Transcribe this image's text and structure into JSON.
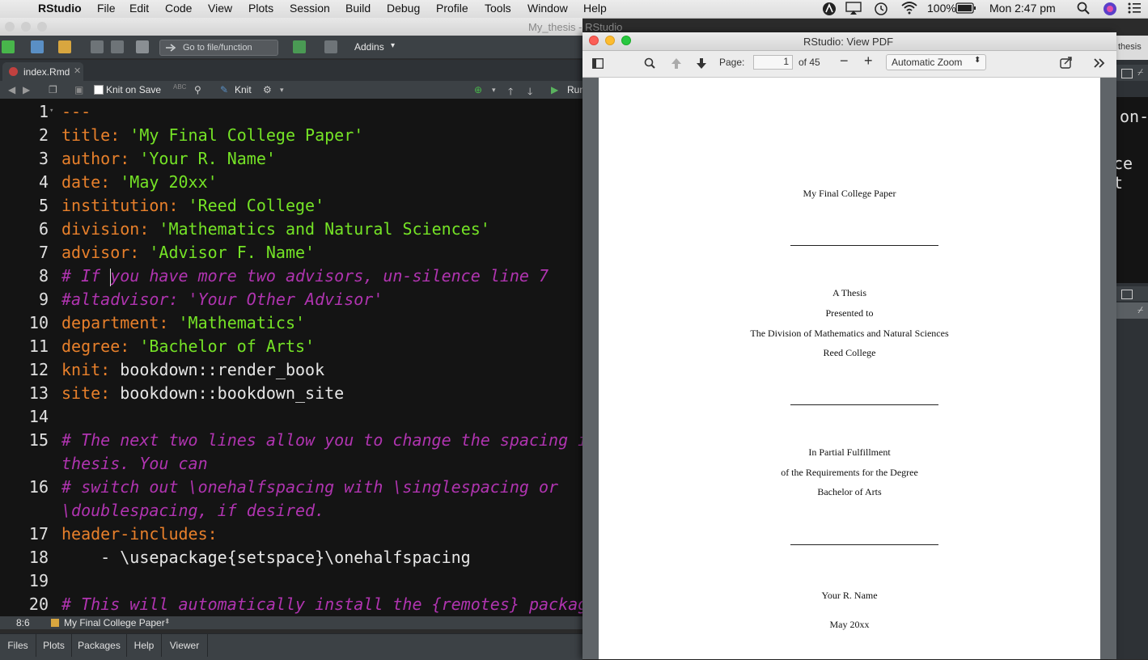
{
  "menubar": {
    "app": "RStudio",
    "items": [
      "File",
      "Edit",
      "Code",
      "View",
      "Plots",
      "Session",
      "Build",
      "Debug",
      "Profile",
      "Tools",
      "Window",
      "Help"
    ],
    "battery": "100%",
    "clock": "Mon 2:47 pm"
  },
  "rstudio": {
    "window_title": "My_thesis - RStudio",
    "goto_placeholder": "Go to file/function",
    "addins": "Addins",
    "tab": "index.Rmd",
    "knit_on_save": "Knit on Save",
    "knit": "Knit",
    "run": "Run",
    "status_pos": "8:6",
    "status_section": "My Final College Paper",
    "bottom_tabs": [
      "Files",
      "Plots",
      "Packages",
      "Help",
      "Viewer"
    ],
    "right_strip_text": [
      "thesis",
      "on-",
      "ce t"
    ]
  },
  "code_lines": [
    {
      "n": "1",
      "parts": [
        [
          "k",
          "---"
        ]
      ]
    },
    {
      "n": "2",
      "parts": [
        [
          "k",
          "title: "
        ],
        [
          "s",
          "'My Final College Paper'"
        ]
      ]
    },
    {
      "n": "3",
      "parts": [
        [
          "k",
          "author: "
        ],
        [
          "s",
          "'Your R. Name'"
        ]
      ]
    },
    {
      "n": "4",
      "parts": [
        [
          "k",
          "date: "
        ],
        [
          "s",
          "'May 20xx'"
        ]
      ]
    },
    {
      "n": "5",
      "parts": [
        [
          "k",
          "institution: "
        ],
        [
          "s",
          "'Reed College'"
        ]
      ]
    },
    {
      "n": "6",
      "parts": [
        [
          "k",
          "division: "
        ],
        [
          "s",
          "'Mathematics and Natural Sciences'"
        ]
      ]
    },
    {
      "n": "7",
      "parts": [
        [
          "k",
          "advisor: "
        ],
        [
          "s",
          "'Advisor F. Name'"
        ]
      ]
    },
    {
      "n": "8",
      "parts": [
        [
          "c",
          "# If you have more two advisors, un-silence line 7"
        ]
      ]
    },
    {
      "n": "9",
      "parts": [
        [
          "c",
          "#altadvisor: 'Your Other Advisor'"
        ]
      ]
    },
    {
      "n": "10",
      "parts": [
        [
          "k",
          "department: "
        ],
        [
          "s",
          "'Mathematics'"
        ]
      ]
    },
    {
      "n": "11",
      "parts": [
        [
          "k",
          "degree: "
        ],
        [
          "s",
          "'Bachelor of Arts'"
        ]
      ]
    },
    {
      "n": "12",
      "parts": [
        [
          "k",
          "knit: "
        ],
        [
          "p",
          "bookdown::render_book"
        ]
      ]
    },
    {
      "n": "13",
      "parts": [
        [
          "k",
          "site: "
        ],
        [
          "p",
          "bookdown::bookdown_site"
        ]
      ]
    },
    {
      "n": "14",
      "parts": []
    },
    {
      "n": "15",
      "parts": [
        [
          "c",
          "# The next two lines allow you to change the spacing i"
        ]
      ]
    },
    {
      "n": "",
      "parts": [
        [
          "c",
          "thesis. You can"
        ]
      ]
    },
    {
      "n": "16",
      "parts": [
        [
          "c",
          "# switch out \\onehalfspacing with \\singlespacing or"
        ]
      ]
    },
    {
      "n": "",
      "parts": [
        [
          "c",
          "\\doublespacing, if desired."
        ]
      ]
    },
    {
      "n": "17",
      "parts": [
        [
          "k",
          "header-includes:"
        ]
      ]
    },
    {
      "n": "18",
      "parts": [
        [
          "p",
          "    - \\usepackage{setspace}\\onehalfspacing"
        ]
      ]
    },
    {
      "n": "19",
      "parts": []
    },
    {
      "n": "20",
      "parts": [
        [
          "c",
          "# This will automatically install the {remotes} packag"
        ]
      ]
    }
  ],
  "pdf": {
    "window_title": "RStudio: View PDF",
    "page_label": "Page:",
    "page_value": "1",
    "of_pages": "of 45",
    "zoom": "Automatic Zoom",
    "title": "My Final College Paper",
    "block1": [
      "A Thesis",
      "Presented to",
      "The Division of Mathematics and Natural Sciences",
      "Reed College"
    ],
    "block2": [
      "In Partial Fulfillment",
      "of the Requirements for the Degree",
      "Bachelor of Arts"
    ],
    "author": "Your R. Name",
    "date": "May 20xx"
  }
}
